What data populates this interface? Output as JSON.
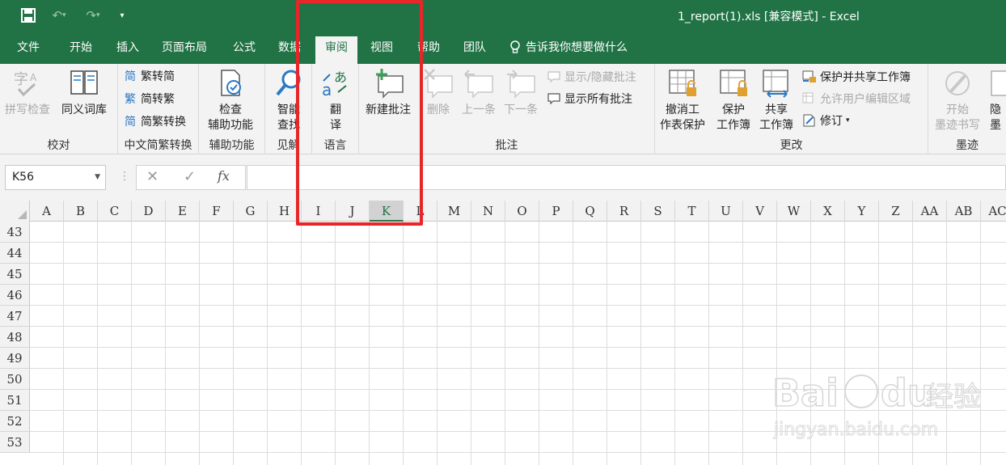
{
  "titlebar": {
    "title": "1_report(1).xls  [兼容模式]  -  Excel",
    "save_icon": "save-icon",
    "undo_icon": "undo-icon",
    "redo_icon": "redo-icon",
    "customize_icon": "customize-qat-icon"
  },
  "tabs": [
    "文件",
    "开始",
    "插入",
    "页面布局",
    "公式",
    "数据",
    "审阅",
    "视图",
    "帮助",
    "团队"
  ],
  "active_tab": "审阅",
  "tellme": "告诉我你想要做什么",
  "ribbon": {
    "proofing": {
      "label": "校对",
      "spelling": "拼写检查",
      "thesaurus": "同义词库"
    },
    "chinese": {
      "label": "中文简繁转换",
      "to_trad": "繁转简",
      "to_simp": "简转繁",
      "convert": "简繁转换",
      "glyph_a": "简",
      "glyph_b": "繁",
      "glyph_c": "简"
    },
    "accessibility": {
      "label": "辅助功能",
      "check_line1": "检查",
      "check_line2": "辅助功能"
    },
    "insights": {
      "label": "见解",
      "smart_line1": "智能",
      "smart_line2": "查找"
    },
    "language": {
      "label": "语言",
      "translate_line1": "翻",
      "translate_line2": "译"
    },
    "comments": {
      "label": "批注",
      "new": "新建批注",
      "delete": "删除",
      "prev": "上一条",
      "next": "下一条",
      "showhide": "显示/隐藏批注",
      "showall": "显示所有批注"
    },
    "changes": {
      "label": "更改",
      "unprotect_line1": "撤消工",
      "unprotect_line2": "作表保护",
      "protect_line1": "保护",
      "protect_line2": "工作簿",
      "share_line1": "共享",
      "share_line2": "工作簿",
      "protect_share": "保护并共享工作簿",
      "allow_edit": "允许用户编辑区域",
      "track": "修订"
    },
    "ink": {
      "label": "墨迹",
      "start_line1": "开始",
      "start_line2": "墨迹书写",
      "hide_line1": "隐",
      "hide_line2": "墨"
    }
  },
  "formula": {
    "namebox": "K56",
    "cancel": "✕",
    "enter": "✓",
    "fx": "fx",
    "sep": "⋮",
    "value": ""
  },
  "columns": [
    "A",
    "B",
    "C",
    "D",
    "E",
    "F",
    "G",
    "H",
    "I",
    "J",
    "K",
    "L",
    "M",
    "N",
    "O",
    "P",
    "Q",
    "R",
    "S",
    "T",
    "U",
    "V",
    "W",
    "X",
    "Y",
    "Z",
    "AA",
    "AB",
    "AC"
  ],
  "selected_column": "K",
  "rows": [
    "43",
    "44",
    "45",
    "46",
    "47",
    "48",
    "49",
    "50",
    "51",
    "52",
    "53"
  ],
  "watermark": {
    "brand": "Bai",
    "brand2": "du",
    "cn": "经验",
    "url": "jingyan.baidu.com"
  },
  "colors": {
    "excel_green": "#217346",
    "highlight_red": "#e8262a"
  }
}
